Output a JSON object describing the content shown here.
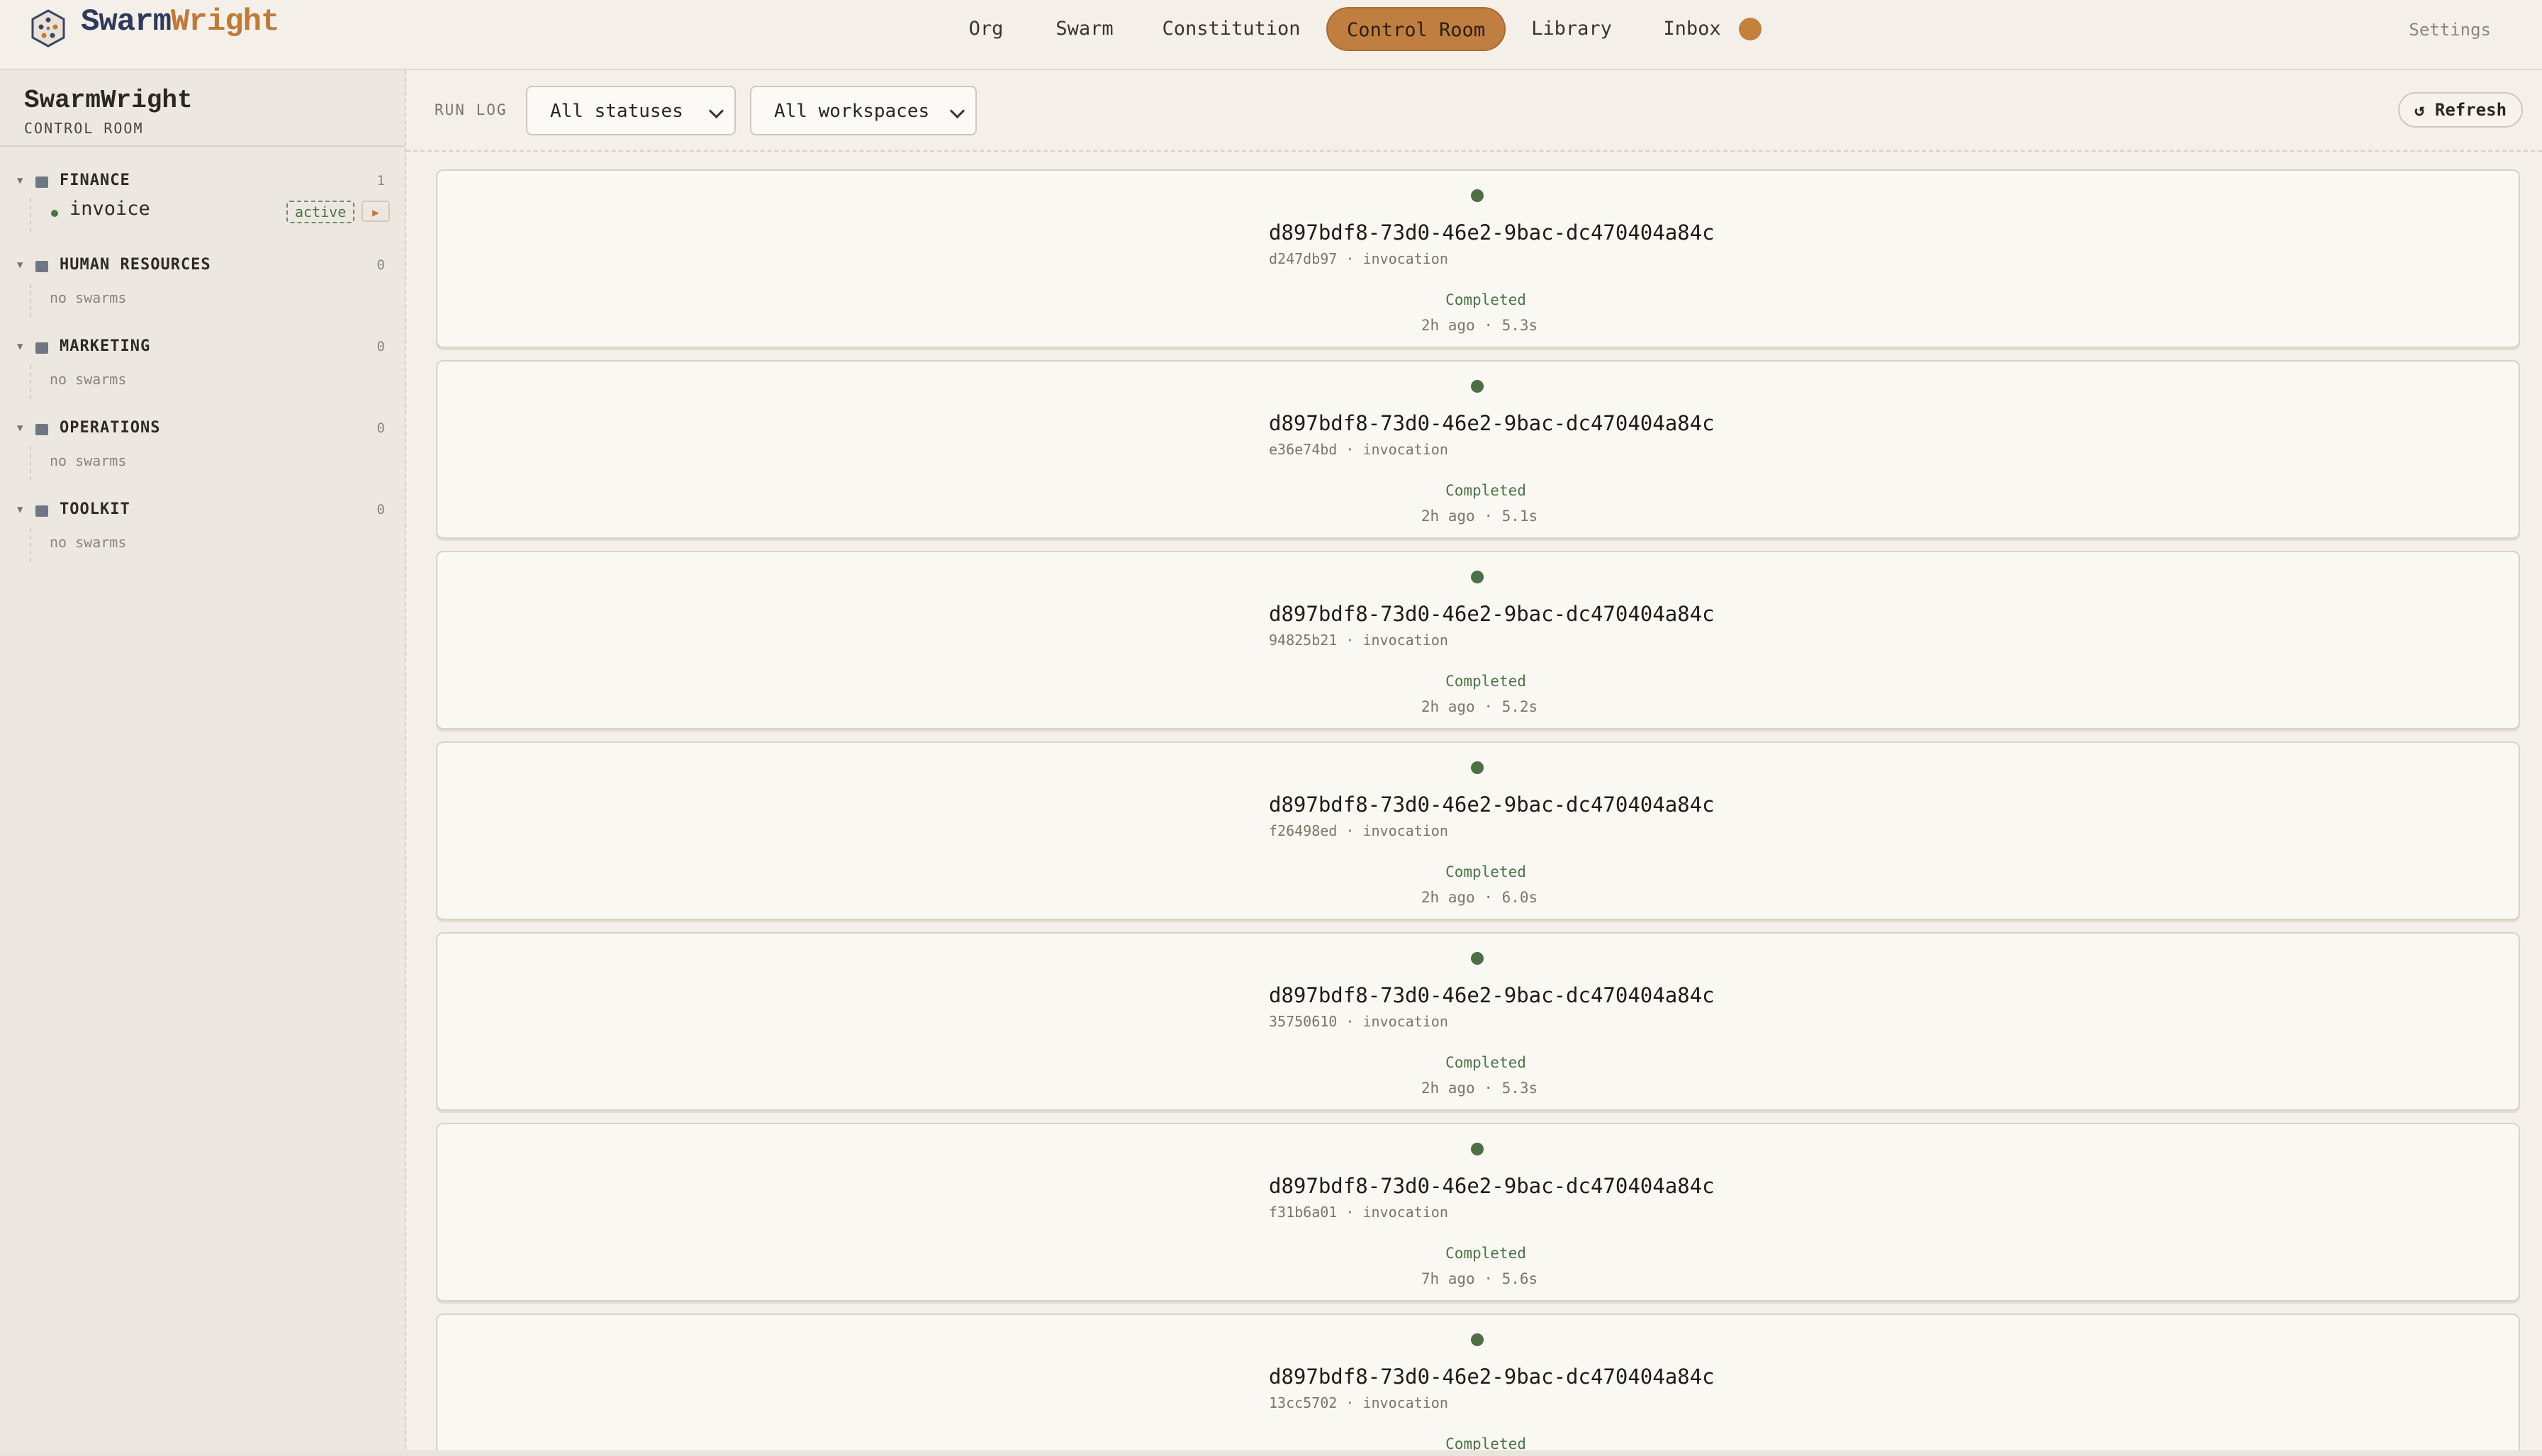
{
  "app": {
    "brand_part1": "Swarm",
    "brand_part2": "Wright"
  },
  "nav": {
    "items": [
      {
        "label": "Org"
      },
      {
        "label": "Swarm"
      },
      {
        "label": "Constitution"
      },
      {
        "label": "Control Room",
        "active": true
      },
      {
        "label": "Library"
      },
      {
        "label": "Inbox"
      }
    ],
    "settings_label": "Settings"
  },
  "sidebar": {
    "title": "SwarmWright",
    "subtitle": "CONTROL ROOM",
    "groups": [
      {
        "name": "FINANCE",
        "count": "1",
        "swarms": [
          {
            "name": "invoice",
            "status": "active"
          }
        ]
      },
      {
        "name": "HUMAN RESOURCES",
        "count": "0",
        "empty_text": "no swarms"
      },
      {
        "name": "MARKETING",
        "count": "0",
        "empty_text": "no swarms"
      },
      {
        "name": "OPERATIONS",
        "count": "0",
        "empty_text": "no swarms"
      },
      {
        "name": "TOOLKIT",
        "count": "0",
        "empty_text": "no swarms"
      }
    ]
  },
  "toolbar": {
    "label": "RUN LOG",
    "status_filter": "All statuses",
    "workspace_filter": "All workspaces",
    "refresh_label": "↺ Refresh"
  },
  "runs": [
    {
      "id": "d897bdf8-73d0-46e2-9bac-dc470404a84c",
      "short": "d247db97",
      "kind": "invocation",
      "status": "Completed",
      "age": "2h ago",
      "duration": "5.3s"
    },
    {
      "id": "d897bdf8-73d0-46e2-9bac-dc470404a84c",
      "short": "e36e74bd",
      "kind": "invocation",
      "status": "Completed",
      "age": "2h ago",
      "duration": "5.1s"
    },
    {
      "id": "d897bdf8-73d0-46e2-9bac-dc470404a84c",
      "short": "94825b21",
      "kind": "invocation",
      "status": "Completed",
      "age": "2h ago",
      "duration": "5.2s"
    },
    {
      "id": "d897bdf8-73d0-46e2-9bac-dc470404a84c",
      "short": "f26498ed",
      "kind": "invocation",
      "status": "Completed",
      "age": "2h ago",
      "duration": "6.0s"
    },
    {
      "id": "d897bdf8-73d0-46e2-9bac-dc470404a84c",
      "short": "35750610",
      "kind": "invocation",
      "status": "Completed",
      "age": "2h ago",
      "duration": "5.3s"
    },
    {
      "id": "d897bdf8-73d0-46e2-9bac-dc470404a84c",
      "short": "f31b6a01",
      "kind": "invocation",
      "status": "Completed",
      "age": "7h ago",
      "duration": "5.6s"
    },
    {
      "id": "d897bdf8-73d0-46e2-9bac-dc470404a84c",
      "short": "13cc5702",
      "kind": "invocation",
      "status": "Completed",
      "age": "",
      "duration": ""
    }
  ],
  "colors": {
    "accent": "#c07f41",
    "success": "#4d7348",
    "brand_dark": "#2e3a5c",
    "brand_orange": "#c07a3a"
  }
}
